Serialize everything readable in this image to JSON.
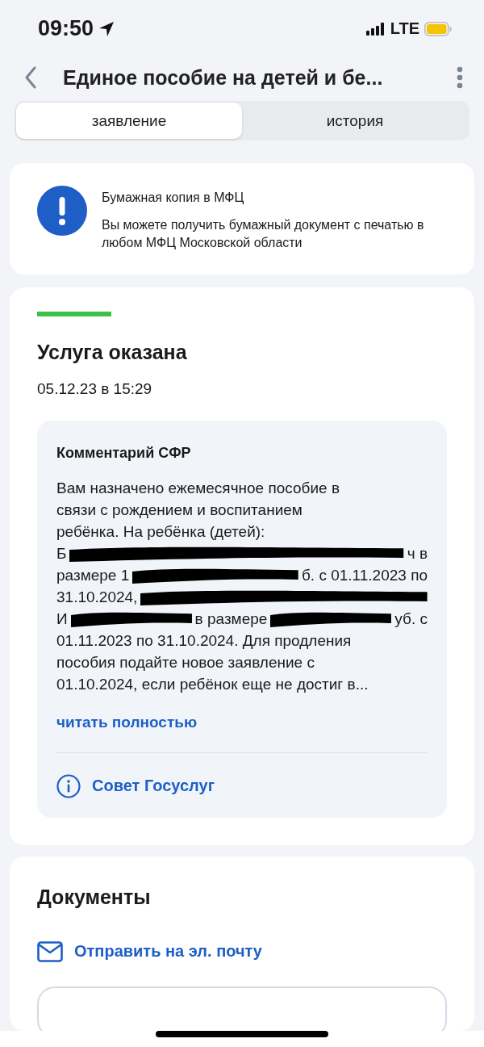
{
  "status_bar": {
    "time": "09:50",
    "network": "LTE"
  },
  "header": {
    "title": "Единое пособие на детей и бе..."
  },
  "tabs": [
    {
      "label": "заявление",
      "selected": true
    },
    {
      "label": "история",
      "selected": false
    }
  ],
  "notice": {
    "title": "Бумажная копия в МФЦ",
    "text": "Вы можете получить бумажный документ с печатью в любом МФЦ Московской области"
  },
  "status": {
    "level": 1,
    "title": "Услуга оказана",
    "date": "05.12.23 в 15:29"
  },
  "comment": {
    "title": "Комментарий СФР",
    "lines": [
      [
        {
          "kind": "text",
          "text": "Вам назначено ежемесячное пособие в"
        }
      ],
      [
        {
          "kind": "text",
          "text": "связи с рождением и воспитанием"
        }
      ],
      [
        {
          "kind": "text",
          "text": "ребёнка. На ребёнка (детей):"
        }
      ],
      [
        {
          "kind": "text",
          "text": "Б"
        },
        {
          "kind": "redaction"
        },
        {
          "kind": "text",
          "text": "ч в"
        }
      ],
      [
        {
          "kind": "text",
          "text": "размере 1"
        },
        {
          "kind": "redaction"
        },
        {
          "kind": "text",
          "text": "б. с 01.11.2023 по"
        }
      ],
      [
        {
          "kind": "text",
          "text": "31.10.2024,"
        },
        {
          "kind": "redaction"
        }
      ],
      [
        {
          "kind": "text",
          "text": "И"
        },
        {
          "kind": "redaction"
        },
        {
          "kind": "text",
          "text": "в размере"
        },
        {
          "kind": "redaction"
        },
        {
          "kind": "text",
          "text": "уб. с"
        }
      ],
      [
        {
          "kind": "text",
          "text": "01.11.2023 по 31.10.2024. Для продления"
        }
      ],
      [
        {
          "kind": "text",
          "text": "пособия подайте новое заявление с"
        }
      ],
      [
        {
          "kind": "text",
          "text": "01.10.2024, если ребёнок еще не достиг в..."
        }
      ]
    ],
    "read_more": "читать полностью",
    "tip": "Совет Госуслуг"
  },
  "documents": {
    "title": "Документы",
    "email_link": "Отправить на эл. почту"
  }
}
